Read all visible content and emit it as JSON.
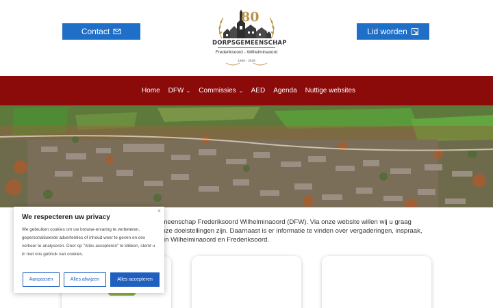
{
  "header": {
    "contact_label": "Contact",
    "contact_icon": "envelope-icon",
    "lid_label": "Lid worden",
    "lid_icon": "external-link-icon",
    "logo": {
      "number": "80",
      "title": "DORPSGEMEENSCHAP",
      "subtitle": "Frederiksoord - Wilhelminaoord",
      "years": "1946 - 2026"
    }
  },
  "nav": {
    "items": [
      {
        "label": "Home",
        "has_dropdown": false
      },
      {
        "label": "DFW",
        "has_dropdown": true
      },
      {
        "label": "Commissies",
        "has_dropdown": true
      },
      {
        "label": "AED",
        "has_dropdown": false
      },
      {
        "label": "Agenda",
        "has_dropdown": false
      },
      {
        "label": "Nuttige websites",
        "has_dropdown": false
      }
    ],
    "chevron": "⌄"
  },
  "intro": {
    "line1": "emeenschap Frederiksoord Wilhelminaoord (DFW). Via onze website willen wij u graag",
    "line2": "onze doelstellingen zijn. Daarnaast is er informatie te vinden over vergaderingen, inspraak,",
    "line3": "n in Wilhelminaoord en Frederiksoord."
  },
  "cookie": {
    "title": "We respecteren uw privacy",
    "body": "We gebruiken cookies om uw browse-ervaring te verbeteren, gepersonaliseerde advertenties of inhoud weer te geven en ons verkeer te analyseren. Door op \"Alles accepteren\" te klikken, stemt u in met ons gebruik van cookies.",
    "close": "×",
    "btn_customize": "Aanpassen",
    "btn_reject": "Alles afwijzen",
    "btn_accept": "Alles accepteren"
  },
  "colors": {
    "nav_bg": "#8b0a0a",
    "button_blue": "#1f6fc8",
    "cookie_blue": "#1f5fc0",
    "logo_gold": "#b8944a"
  }
}
